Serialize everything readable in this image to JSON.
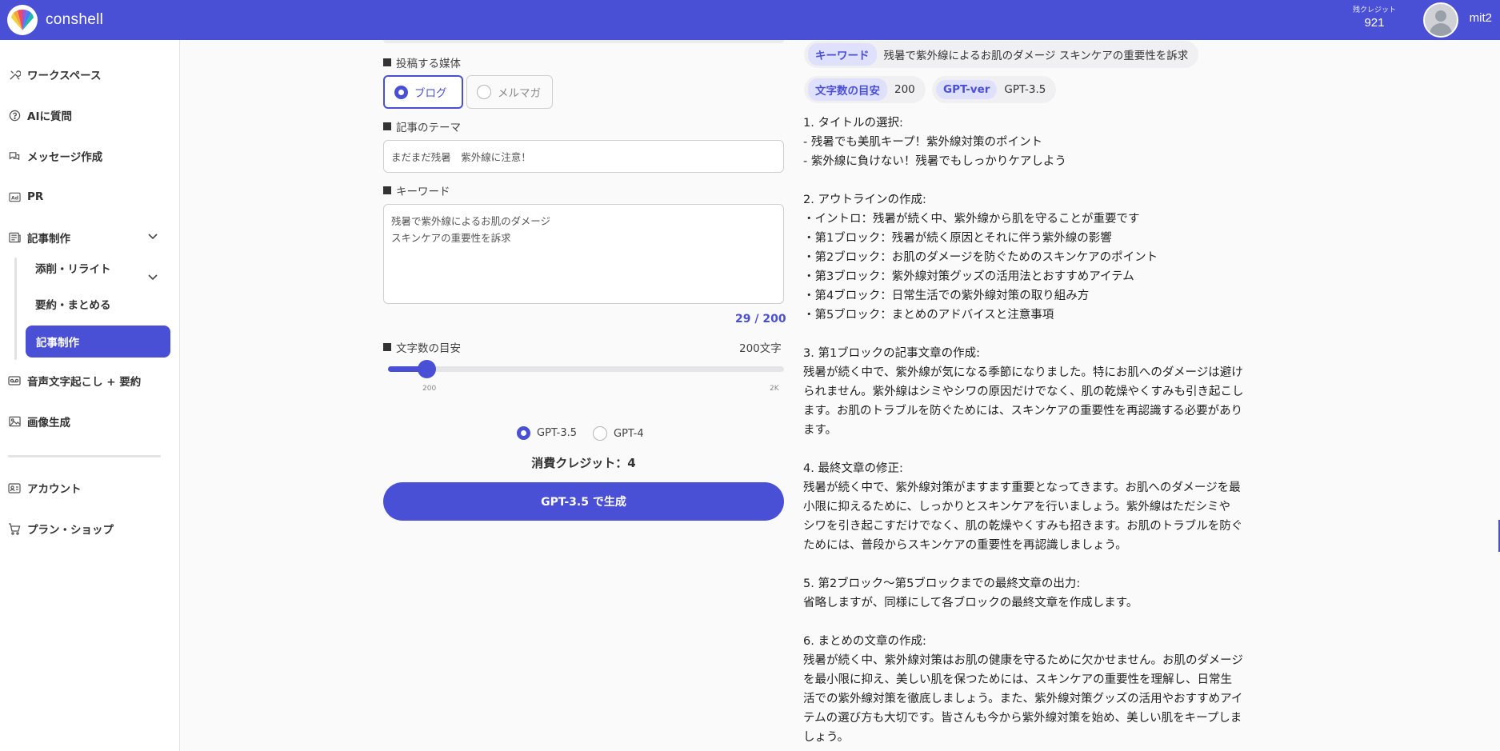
{
  "header": {
    "brand": "conshell",
    "credit_label": "残クレジット",
    "credit_value": "921",
    "username": "mit2"
  },
  "sidebar": {
    "items": [
      {
        "label": "ワークスペース",
        "icon": "tools-icon"
      },
      {
        "label": "AIに質問",
        "icon": "question-bubble-icon"
      },
      {
        "label": "メッセージ作成",
        "icon": "chat-bubbles-icon"
      },
      {
        "label": "PR",
        "icon": "ad-icon"
      },
      {
        "label": "記事制作",
        "icon": "newspaper-icon"
      },
      {
        "label": "音声文字起こし + 要約",
        "icon": "tape-icon"
      },
      {
        "label": "画像生成",
        "icon": "image-icon"
      },
      {
        "label": "アカウント",
        "icon": "id-card-icon"
      },
      {
        "label": "プラン・ショップ",
        "icon": "cart-icon"
      }
    ],
    "sub_items": [
      "添削・リライト",
      "要約・まとめる",
      "記事制作"
    ],
    "active_sub": "記事制作"
  },
  "form": {
    "media_label": "投稿する媒体",
    "media_options": [
      "ブログ",
      "メルマガ"
    ],
    "media_selected": "ブログ",
    "theme_label": "記事のテーマ",
    "theme_value": "まだまだ残暑　紫外線に注意！",
    "keyword_label": "キーワード",
    "keyword_value": "残暑で紫外線によるお肌のダメージ\nスキンケアの重要性を訴求",
    "counter": "29 / 200",
    "size_label": "文字数の目安",
    "size_value": "200文字",
    "slider": {
      "min_label": "200",
      "max_label": "2K",
      "level": 0.0
    },
    "models": [
      "GPT-3.5",
      "GPT-4"
    ],
    "model_selected": "GPT-3.5",
    "cost": "消費クレジット：4",
    "generate_label": "GPT-3.5 で生成"
  },
  "result": {
    "keyword_chip": "キーワード",
    "keyword_value": "残暑で紫外線によるお肌のダメージ スキンケアの重要性を訴求",
    "size_chip": "文字数の目安",
    "size_value": "200",
    "ver_chip": "GPT-ver",
    "ver_value": "GPT-3.5",
    "sections": [
      "1. タイトルの選択:\n- 残暑でも美肌キープ！紫外線対策のポイント\n- 紫外線に負けない！残暑でもしっかりケアしよう",
      "2. アウトラインの作成:\n・イントロ：残暑が続く中、紫外線から肌を守ることが重要です\n・第1ブロック：残暑が続く原因とそれに伴う紫外線の影響\n・第2ブロック：お肌のダメージを防ぐためのスキンケアのポイント\n・第3ブロック：紫外線対策グッズの活用法とおすすめアイテム\n・第4ブロック：日常生活での紫外線対策の取り組み方\n・第5ブロック：まとめのアドバイスと注意事項",
      "3. 第1ブロックの記事文章の作成:\n残暑が続く中で、紫外線が気になる季節になりました。特にお肌へのダメージは避け\nられません。紫外線はシミやシワの原因だけでなく、肌の乾燥やくすみも引き起こし\nます。お肌のトラブルを防ぐためには、スキンケアの重要性を再認識する必要があり\nます。",
      "4. 最終文章の修正:\n残暑が続く中で、紫外線対策がますます重要となってきます。お肌へのダメージを最\n小限に抑えるために、しっかりとスキンケアを行いましょう。紫外線はただシミや\nシワを引き起こすだけでなく、肌の乾燥やくすみも招きます。お肌のトラブルを防ぐ\nためには、普段からスキンケアの重要性を再認識しましょう。",
      "5. 第2ブロック〜第5ブロックまでの最終文章の出力:\n省略しますが、同様にして各ブロックの最終文章を作成します。",
      "6. まとめの文章の作成:\n残暑が続く中、紫外線対策はお肌の健康を守るために欠かせません。お肌のダメージ\nを最小限に抑え、美しい肌を保つためには、スキンケアの重要性を理解し、日常生\n活での紫外線対策を徹底しましょう。また、紫外線対策グッズの活用やおすすめアイ\nテムの選び方も大切です。皆さんも今から紫外線対策を始め、美しい肌をキープしま\nしょう。"
    ]
  },
  "colors": {
    "accent": "#4a50d6",
    "chip_bg": "#dfe0fb"
  }
}
